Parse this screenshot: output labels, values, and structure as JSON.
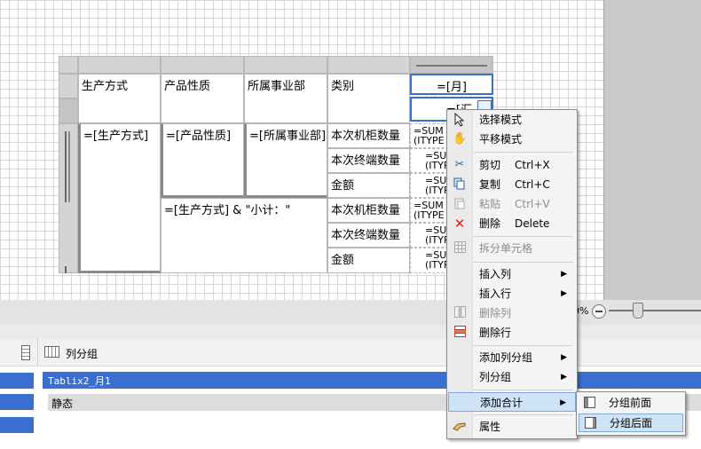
{
  "table": {
    "headers": [
      "生产方式",
      "产品性质",
      "所属事业部",
      "类别",
      "=[月]"
    ],
    "row_col1": "=[生产方式]",
    "row_col2": "=[产品性质]",
    "row_col3": "=[所属事业部]",
    "subtotal_label": "=[生产方式] & \"小计：\"",
    "partial_cell": "=[汇",
    "categories": [
      "本次机柜数量",
      "本次终端数量",
      "金额",
      "本次机柜数量",
      "本次终端数量",
      "金额"
    ],
    "values": [
      {
        "l1": "=SUM",
        "l2": "(ITYPE"
      },
      {
        "l1": "=SU",
        "l2": "(ITYP"
      },
      {
        "l1": "=SU",
        "l2": "(ITYP"
      },
      {
        "l1": "=SUM",
        "l2": "(ITYPE"
      },
      {
        "l1": "=SU",
        "l2": "(ITYP"
      },
      {
        "l1": "=SU",
        "l2": "(ITYP"
      }
    ]
  },
  "zoom": {
    "percent_label": "0%"
  },
  "group_panel": {
    "title": "列分组",
    "item_tablix": "Tablix2_月1",
    "item_static": "静态"
  },
  "menu": {
    "select_mode": "选择模式",
    "pan_mode": "平移模式",
    "cut": "剪切",
    "cut_sc": "Ctrl+X",
    "copy": "复制",
    "copy_sc": "Ctrl+C",
    "paste": "粘贴",
    "paste_sc": "Ctrl+V",
    "delete": "删除",
    "delete_sc": "Delete",
    "split_cells": "拆分单元格",
    "insert_col": "插入列",
    "insert_row": "插入行",
    "delete_col": "删除列",
    "delete_row": "删除行",
    "add_col_group": "添加列分组",
    "col_group": "列分组",
    "add_total": "添加合计",
    "properties": "属性"
  },
  "submenu": {
    "before": "分组前面",
    "after": "分组后面"
  },
  "colors": {
    "selection": "#3a6fd0",
    "highlight": "#cfe3f7"
  }
}
